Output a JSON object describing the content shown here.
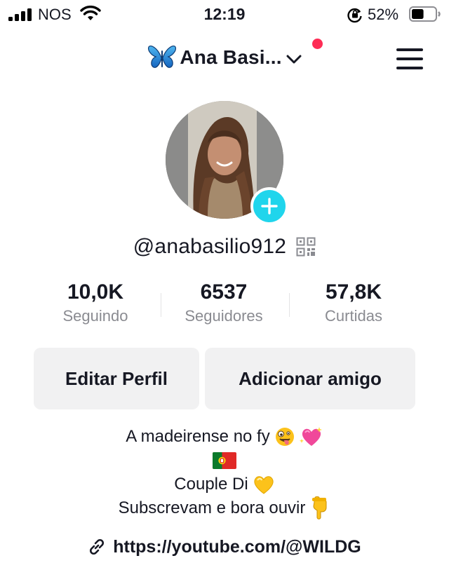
{
  "status_bar": {
    "carrier": "NOS",
    "time": "12:19",
    "battery_percent": "52%",
    "battery_level": 0.52,
    "icons": [
      "signal-icon",
      "wifi-icon",
      "rotation-lock-icon",
      "battery-icon"
    ]
  },
  "header": {
    "account_name": "Ana Basi...",
    "icons": [
      "butterfly-icon",
      "chevron-down-icon",
      "menu-icon"
    ],
    "notification_dot_color": "#fe2c55"
  },
  "profile": {
    "username": "@anabasilio912",
    "avatar_add_color": "#20d5ec",
    "stats": [
      {
        "value": "10,0K",
        "label": "Seguindo"
      },
      {
        "value": "6537",
        "label": "Seguidores"
      },
      {
        "value": "57,8K",
        "label": "Curtidas"
      }
    ],
    "buttons": {
      "edit": "Editar Perfil",
      "add_friend": "Adicionar amigo"
    },
    "bio": {
      "line1": "A madeirense no fy",
      "line3": "Couple Di",
      "line4": "Subscrevam e bora ouvir"
    },
    "link": "https://youtube.com/@WILDG"
  },
  "colors": {
    "text": "#161823",
    "secondary": "#8a8b91",
    "button_bg": "#f1f1f2"
  }
}
